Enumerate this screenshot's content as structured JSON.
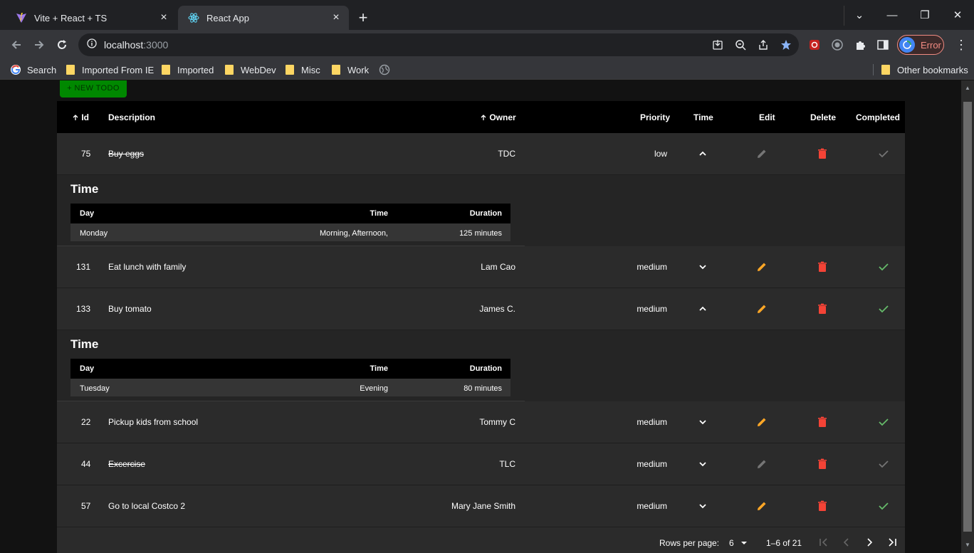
{
  "browser": {
    "tabs": [
      {
        "title": "Vite + React + TS",
        "active": false
      },
      {
        "title": "React App",
        "active": true
      }
    ],
    "url_host": "localhost",
    "url_port": ":3000",
    "profile_label": "Error",
    "bookmarks": [
      {
        "label": "Search",
        "icon": "google-icon"
      },
      {
        "label": "Imported From IE",
        "icon": "folder-icon"
      },
      {
        "label": "Imported",
        "icon": "folder-icon"
      },
      {
        "label": "WebDev",
        "icon": "folder-icon"
      },
      {
        "label": "Misc",
        "icon": "folder-icon"
      },
      {
        "label": "Work",
        "icon": "folder-icon"
      }
    ],
    "other_bookmarks": "Other bookmarks"
  },
  "page": {
    "new_button": "+ NEW TODO",
    "columns": {
      "id": "Id",
      "description": "Description",
      "owner": "Owner",
      "priority": "Priority",
      "time": "Time",
      "edit": "Edit",
      "delete": "Delete",
      "completed": "Completed"
    },
    "rows": [
      {
        "id": "75",
        "description": "Buy eggs",
        "owner": "TDC",
        "priority": "low",
        "done": true,
        "expanded": true
      },
      {
        "id": "131",
        "description": "Eat lunch with family",
        "owner": "Lam Cao",
        "priority": "medium",
        "done": false,
        "expanded": false
      },
      {
        "id": "133",
        "description": "Buy tomato",
        "owner": "James C.",
        "priority": "medium",
        "done": false,
        "expanded": true
      },
      {
        "id": "22",
        "description": "Pickup kids from school",
        "owner": "Tommy C",
        "priority": "medium",
        "done": false,
        "expanded": false
      },
      {
        "id": "44",
        "description": "Excercise",
        "owner": "TLC",
        "priority": "medium",
        "done": true,
        "expanded": false
      },
      {
        "id": "57",
        "description": "Go to local Costco 2",
        "owner": "Mary Jane Smith",
        "priority": "medium",
        "done": false,
        "expanded": false
      }
    ],
    "subtables": [
      {
        "title": "Time",
        "headers": {
          "day": "Day",
          "time": "Time",
          "duration": "Duration"
        },
        "day": "Monday",
        "time": "Morning, Afternoon,",
        "duration": "125 minutes"
      },
      {
        "title": "Time",
        "headers": {
          "day": "Day",
          "time": "Time",
          "duration": "Duration"
        },
        "day": "Tuesday",
        "time": "Evening",
        "duration": "80 minutes"
      }
    ],
    "pagination": {
      "rows_per_page_label": "Rows per page:",
      "rows_per_page": "6",
      "range": "1–6 of 21"
    }
  },
  "colors": {
    "edit_active": "#ffa726",
    "edit_disabled": "#757575",
    "delete": "#f44336",
    "check_active": "#66bb6a",
    "check_disabled": "#757575",
    "new_button": "#008800"
  }
}
